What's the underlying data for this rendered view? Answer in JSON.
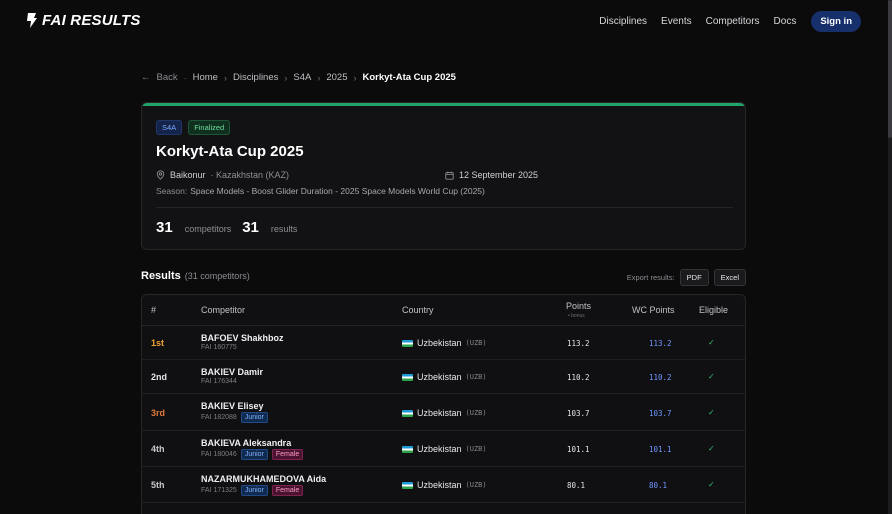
{
  "header": {
    "logo": "FAI RESULTS",
    "nav": [
      "Disciplines",
      "Events",
      "Competitors",
      "Docs"
    ],
    "signin": "Sign in"
  },
  "breadcrumb": {
    "back": "Back",
    "items": [
      "Home",
      "Disciplines",
      "S4A",
      "2025"
    ],
    "current": "Korkyt-Ata Cup 2025"
  },
  "event": {
    "class_badge": "S4A",
    "status_badge": "Finalized",
    "title": "Korkyt-Ata Cup 2025",
    "city": "Baikonur",
    "country": "· Kazakhstan (KAZ)",
    "date": "12 September 2025",
    "season_label": "Season:",
    "season_value": "Space Models - Boost Glider Duration - 2025 Space Models World Cup (2025)",
    "competitors_count": "31",
    "competitors_label": "competitors",
    "results_count": "31",
    "results_label": "results"
  },
  "results": {
    "title": "Results",
    "subtitle": "(31 competitors)",
    "export_label": "Export results:",
    "export_pdf": "PDF",
    "export_excel": "Excel",
    "columns": {
      "rank": "#",
      "competitor": "Competitor",
      "country": "Country",
      "points": "Points",
      "points_sub": "• bonus",
      "wc_points": "WC Points",
      "eligible": "Eligible"
    },
    "rows": [
      {
        "rank": "1st",
        "rank_color": "#f0a531",
        "name": "BAFOEV Shakhboz",
        "fai": "FAI 160775",
        "tags": [],
        "country": "Uzbekistan",
        "code": "(UZB)",
        "points": "113.2",
        "wc": "113.2",
        "eligible": "✓"
      },
      {
        "rank": "2nd",
        "rank_color": "#e6e6e8",
        "name": "BAKIEV Damir",
        "fai": "FAI 176344",
        "tags": [],
        "country": "Uzbekistan",
        "code": "(UZB)",
        "points": "110.2",
        "wc": "110.2",
        "eligible": "✓"
      },
      {
        "rank": "3rd",
        "rank_color": "#e0783a",
        "name": "BAKIEV Elisey",
        "fai": "FAI 182088",
        "tags": [
          "Junior"
        ],
        "country": "Uzbekistan",
        "code": "(UZB)",
        "points": "103.7",
        "wc": "103.7",
        "eligible": "✓"
      },
      {
        "rank": "4th",
        "rank_color": "#c8c8cc",
        "name": "BAKIEVA Aleksandra",
        "fai": "FAI 180046",
        "tags": [
          "Junior",
          "Female"
        ],
        "country": "Uzbekistan",
        "code": "(UZB)",
        "points": "101.1",
        "wc": "101.1",
        "eligible": "✓"
      },
      {
        "rank": "5th",
        "rank_color": "#c8c8cc",
        "name": "NAZARMUKHAMEDOVA Aida",
        "fai": "FAI 171325",
        "tags": [
          "Junior",
          "Female"
        ],
        "country": "Uzbekistan",
        "code": "(UZB)",
        "points": "80.1",
        "wc": "80.1",
        "eligible": "✓"
      }
    ]
  }
}
